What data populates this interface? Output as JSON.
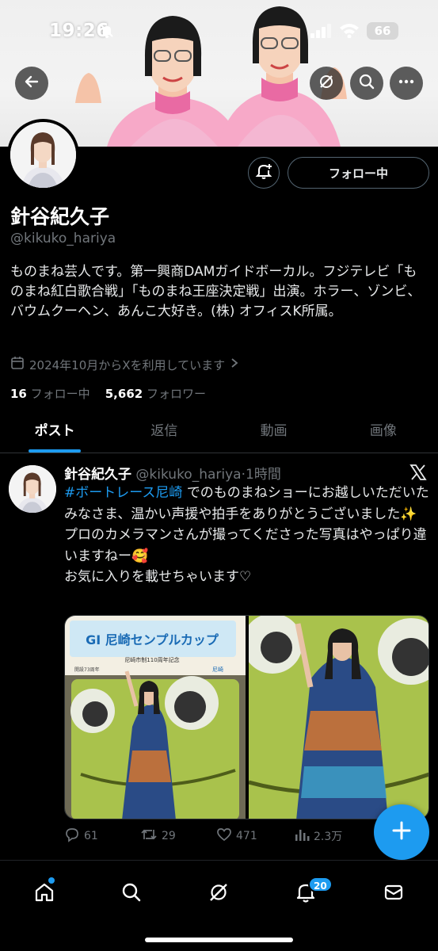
{
  "status_bar": {
    "time": "19:26",
    "battery": "66"
  },
  "profile": {
    "name": "針谷紀久子",
    "handle": "@kikuko_hariya",
    "bio": "ものまね芸人です。第一興商DAMガイドボーカル。フジテレビ「ものまね紅白歌合戦」「ものまね王座決定戦」出演。ホラー、ゾンビ、バウムクーヘン、あんこ大好き。(株) オフィスK所属。",
    "joined": "2024年10月からXを利用しています",
    "following_count": "16",
    "following_label": "フォロー中",
    "followers_count": "5,662",
    "followers_label": "フォロワー",
    "follow_button": "フォロー中"
  },
  "tabs": [
    {
      "label": "ポスト",
      "active": true
    },
    {
      "label": "返信",
      "active": false
    },
    {
      "label": "動画",
      "active": false
    },
    {
      "label": "画像",
      "active": false
    }
  ],
  "post": {
    "name": "針谷紀久子",
    "handle": "@kikuko_hariya",
    "time": "·1時間",
    "hashtag": "#ボートレース尼崎",
    "text_1": "でのものまねショーにお越しいただいたみなさま、温かい声援や拍手をありがとうございました✨",
    "text_2": "プロのカメラマンさんが撮ってくださった写真はやっぱり違いますねー🥰",
    "text_3": "お気に入りを載せちゃいます♡",
    "sign_top": "尼崎市制110周年記念",
    "sign_main": "GI 尼崎センプルカップ",
    "sign_sub": "開設73周年",
    "sign_brand": "尼崎",
    "replies": "61",
    "reposts": "29",
    "likes": "471",
    "views": "2.3万"
  },
  "nav": {
    "notifications_badge": "20"
  },
  "icons": [
    "back-arrow-icon",
    "grok-icon",
    "search-icon",
    "more-icon",
    "bell-plus-icon",
    "calendar-icon",
    "x-logo-icon",
    "reply-icon",
    "repost-icon",
    "like-icon",
    "views-icon",
    "plus-icon",
    "home-icon",
    "bell-icon",
    "mail-icon"
  ],
  "colors": {
    "accent": "#1d9bf0",
    "background": "#000000",
    "muted": "#71767b"
  }
}
